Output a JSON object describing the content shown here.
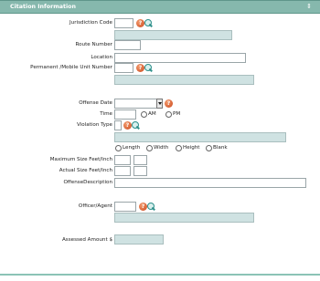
{
  "section": {
    "title": "Citation Information",
    "toggle_icon": "⇕"
  },
  "labels": {
    "jurisdiction_code": "Jurisdiction Code",
    "route_number": "Route Number",
    "location": "Location",
    "permanent_unit_number": "Permanent /Mobile Unit Number",
    "offense_date": "Offense Date",
    "time": "Time",
    "violation_type": "Violation Type",
    "maximum_size": "Maximum Size Feet/Inch",
    "actual_size": "Actual Size Feet/Inch",
    "offense_description": "OffenseDescription",
    "officer_agent": "Officer/Agent",
    "assessed_amount": "Assessed Amount $"
  },
  "help_glyph": "?",
  "time_options": [
    "AM",
    "PM"
  ],
  "size_options": [
    "Length",
    "Width",
    "Height",
    "Blank"
  ],
  "colors": {
    "header": "#86b8ad",
    "readonly": "#cfe2e2",
    "help": "#d4541f",
    "search": "#2c8f8a"
  }
}
